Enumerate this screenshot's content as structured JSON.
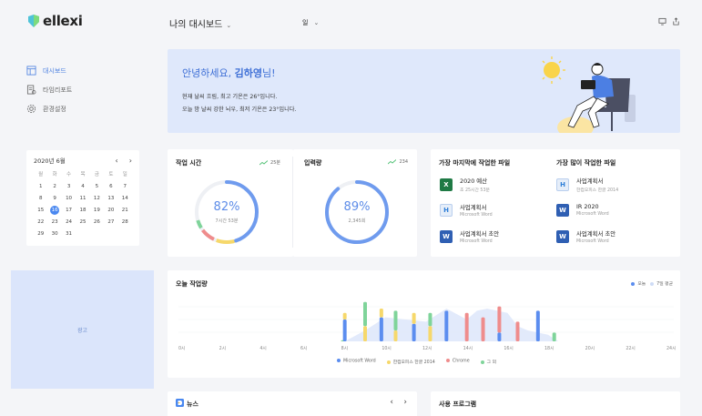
{
  "app": {
    "brand": "ellexi"
  },
  "nav": [
    {
      "label": "대시보드",
      "icon": "dashboard-icon",
      "active": true
    },
    {
      "label": "타임리포트",
      "icon": "report-icon",
      "active": false
    },
    {
      "label": "환경설정",
      "icon": "gear-icon",
      "active": false
    }
  ],
  "topbar": {
    "title": "나의 대시보드",
    "period": "일"
  },
  "calendar": {
    "month": "2020년 6월",
    "dow": [
      "월",
      "화",
      "수",
      "목",
      "금",
      "토",
      "일"
    ],
    "days": [
      [
        "1",
        "2",
        "3",
        "4",
        "5",
        "6",
        "7"
      ],
      [
        "8",
        "9",
        "10",
        "11",
        "12",
        "13",
        "14"
      ],
      [
        "15",
        "16",
        "17",
        "18",
        "19",
        "20",
        "21"
      ],
      [
        "22",
        "23",
        "24",
        "25",
        "26",
        "27",
        "28"
      ],
      [
        "29",
        "30",
        "31",
        "",
        "",
        "",
        ""
      ]
    ],
    "today": "16"
  },
  "ad": {
    "label": "광고"
  },
  "hero": {
    "greeting_prefix": "안녕하세요, ",
    "greeting_name": "김하영",
    "greeting_suffix": "님!",
    "line1": "현재 날씨 흐림, 최고 기온은 26°입니다.",
    "line2": "오늘 밤 날씨 강한 뇌우, 최저 기온은 23°입니다."
  },
  "work_time": {
    "title": "작업 시간",
    "trend": "25분",
    "percent": "82%",
    "sub": "7시간 53분",
    "fraction": 0.82
  },
  "typing": {
    "title": "입력량",
    "trend": "234",
    "percent": "89%",
    "sub": "2,345회",
    "fraction": 0.89
  },
  "recent_files": {
    "title": "가장 마지막에 작업한 파일",
    "items": [
      {
        "name": "2020 예산",
        "sub": "초 25시간 53분",
        "type": "excel"
      },
      {
        "name": "사업계획서",
        "sub": "Microsoft Word",
        "type": "hwp"
      },
      {
        "name": "사업계획서 초안",
        "sub": "Microsoft Word",
        "type": "word"
      }
    ]
  },
  "most_files": {
    "title": "가장 많이 작업한 파일",
    "items": [
      {
        "name": "사업계획서",
        "sub": "한컴오피스 한글 2014",
        "type": "hwp"
      },
      {
        "name": "IR 2020",
        "sub": "Microsoft Word",
        "type": "word"
      },
      {
        "name": "사업계획서 초안",
        "sub": "Microsoft Word",
        "type": "word"
      }
    ]
  },
  "chart_data": {
    "type": "bar",
    "title": "오늘 작업량",
    "legend_top": [
      "오늘",
      "7일 평균"
    ],
    "x_ticks": [
      "0시",
      "2시",
      "4시",
      "6시",
      "8시",
      "10시",
      "12시",
      "14시",
      "16시",
      "18시",
      "20시",
      "22시",
      "24시"
    ],
    "series": [
      {
        "name": "Microsoft Word",
        "color": "#5b8def"
      },
      {
        "name": "한컴오피스 한글 2014",
        "color": "#f6d86b"
      },
      {
        "name": "Chrome",
        "color": "#ef8c8c"
      },
      {
        "name": "그 외",
        "color": "#7fd49a"
      }
    ],
    "bars": [
      {
        "hour": 7.9,
        "segments": [
          0,
          0,
          0,
          1
        ]
      },
      {
        "hour": 8.0,
        "segments": [
          20,
          6,
          0,
          0
        ]
      },
      {
        "hour": 9.0,
        "segments": [
          0,
          14,
          0,
          22
        ]
      },
      {
        "hour": 9.8,
        "segments": [
          22,
          8,
          0,
          0
        ]
      },
      {
        "hour": 10.5,
        "segments": [
          0,
          10,
          0,
          18
        ]
      },
      {
        "hour": 11.4,
        "segments": [
          16,
          10,
          0,
          0
        ]
      },
      {
        "hour": 12.2,
        "segments": [
          0,
          14,
          0,
          12
        ]
      },
      {
        "hour": 13.0,
        "segments": [
          28,
          0,
          0,
          0
        ]
      },
      {
        "hour": 14.0,
        "segments": [
          0,
          0,
          26,
          0
        ]
      },
      {
        "hour": 14.8,
        "segments": [
          0,
          0,
          22,
          0
        ]
      },
      {
        "hour": 15.6,
        "segments": [
          8,
          0,
          24,
          0
        ]
      },
      {
        "hour": 16.5,
        "segments": [
          0,
          0,
          18,
          0
        ]
      },
      {
        "hour": 17.5,
        "segments": [
          28,
          0,
          0,
          0
        ]
      },
      {
        "hour": 18.3,
        "segments": [
          0,
          0,
          0,
          8
        ]
      }
    ],
    "average_area": [
      [
        8,
        0
      ],
      [
        9,
        10
      ],
      [
        10,
        22
      ],
      [
        11,
        20
      ],
      [
        12,
        18
      ],
      [
        13,
        30
      ],
      [
        14,
        20
      ],
      [
        14.5,
        28
      ],
      [
        15,
        30
      ],
      [
        16,
        26
      ],
      [
        16.5,
        14
      ],
      [
        17,
        10
      ],
      [
        18,
        6
      ],
      [
        18.5,
        0
      ]
    ],
    "ymax": 40
  },
  "news": {
    "title": "뉴스"
  },
  "programs": {
    "title": "사용 프로그램"
  }
}
